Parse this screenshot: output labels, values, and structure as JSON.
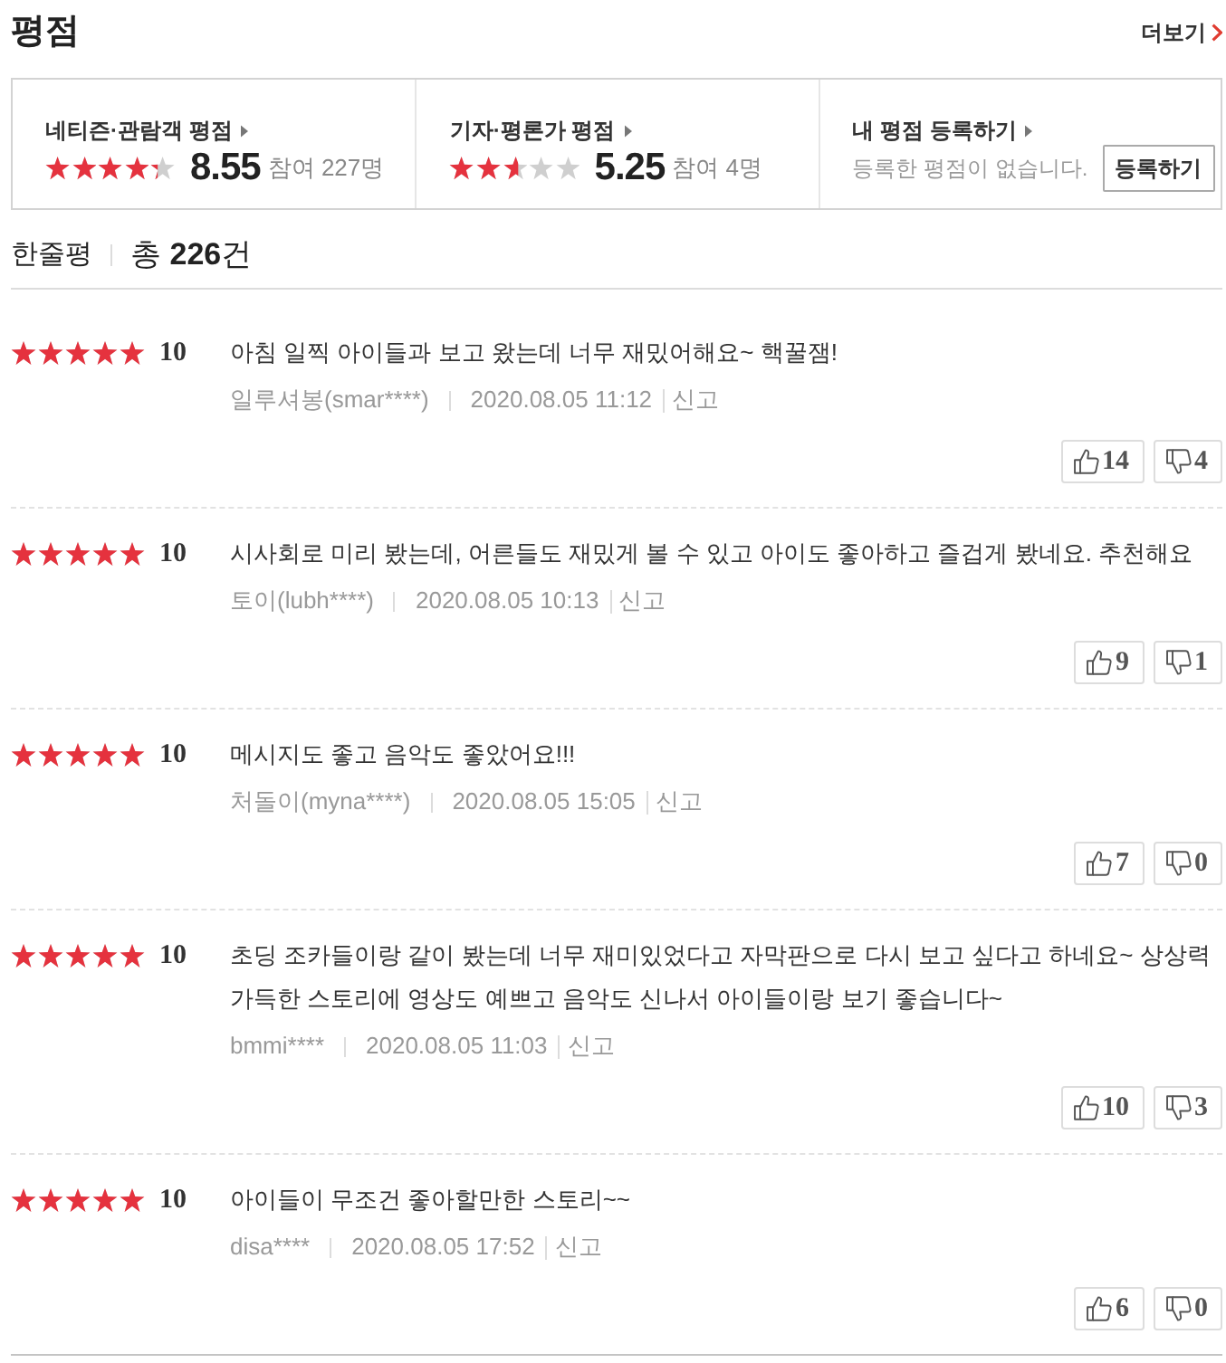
{
  "header": {
    "title": "평점",
    "more_link": "더보기"
  },
  "summary": [
    {
      "kind": "score",
      "label": "네티즌·관람객 평점",
      "stars": 4.3,
      "score": "8.55",
      "participants": "참여 227명"
    },
    {
      "kind": "score",
      "label": "기자·평론가 평점",
      "stars": 2.6,
      "score": "5.25",
      "participants": "참여 4명"
    },
    {
      "kind": "register",
      "label": "내 평점 등록하기",
      "message": "등록한 평점이 없습니다.",
      "button": "등록하기"
    }
  ],
  "reviews_header": {
    "title": "한줄평",
    "total": "총 **226**건"
  },
  "reviews": [
    {
      "stars": 5,
      "score": "10",
      "text": "아침 일찍 아이들과 보고 왔는데 너무 재밌어해요~ 핵꿀잼!",
      "author": "일루셔봉(smar****)",
      "date": "2020.08.05 11:12",
      "report": "신고",
      "likes": "14",
      "dislikes": "4"
    },
    {
      "stars": 5,
      "score": "10",
      "text": "시사회로 미리 봤는데, 어른들도 재밌게 볼 수 있고 아이도 좋아하고 즐겁게 봤네요. 추천해요",
      "author": "토이(lubh****)",
      "date": "2020.08.05 10:13",
      "report": "신고",
      "likes": "9",
      "dislikes": "1"
    },
    {
      "stars": 5,
      "score": "10",
      "text": "메시지도 좋고 음악도 좋았어요!!!",
      "author": "처돌이(myna****)",
      "date": "2020.08.05 15:05",
      "report": "신고",
      "likes": "7",
      "dislikes": "0"
    },
    {
      "stars": 5,
      "score": "10",
      "text": "초딩 조카들이랑 같이 봤는데 너무 재미있었다고 자막판으로 다시 보고 싶다고 하네요~ 상상력 가득한 스토리에 영상도 예쁘고 음악도 신나서 아이들이랑 보기 좋습니다~",
      "author": "bmmi****",
      "date": "2020.08.05 11:03",
      "report": "신고",
      "likes": "10",
      "dislikes": "3"
    },
    {
      "stars": 5,
      "score": "10",
      "text": "아이들이 무조건 좋아할만한 스토리~~",
      "author": "disa****",
      "date": "2020.08.05 17:52",
      "report": "신고",
      "likes": "6",
      "dislikes": "0"
    }
  ]
}
